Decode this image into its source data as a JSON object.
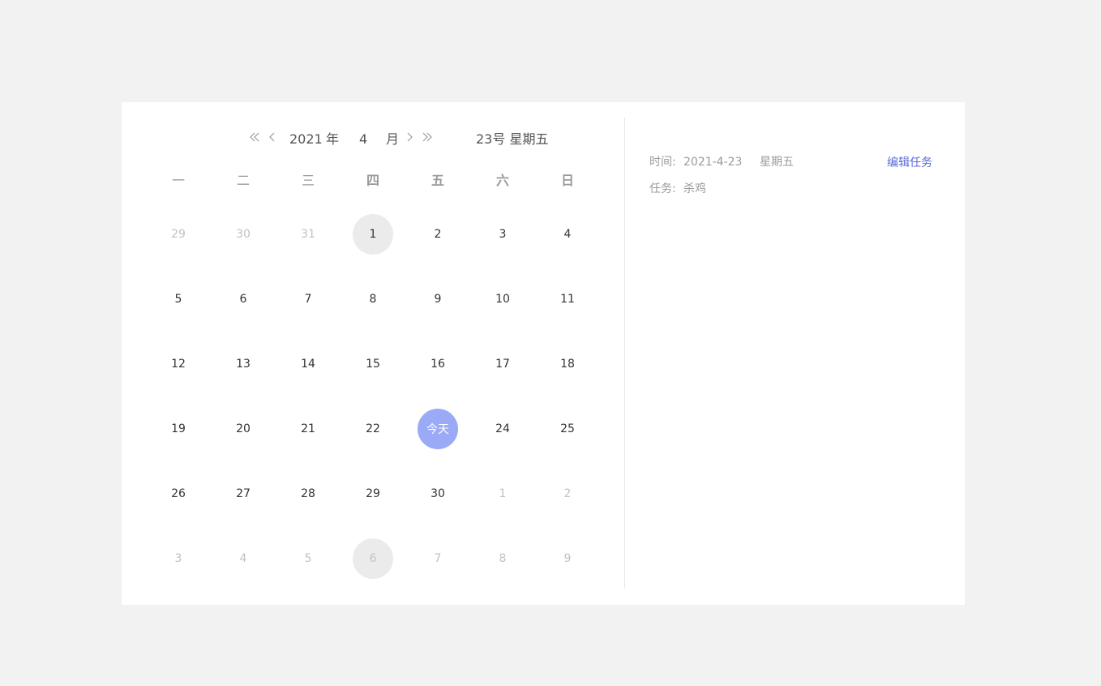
{
  "calendar": {
    "nav": {
      "prev_year_icon": "double-chevron-left-icon",
      "prev_month_icon": "chevron-left-icon",
      "next_month_icon": "chevron-right-icon",
      "next_year_icon": "double-chevron-right-icon"
    },
    "year": "2021",
    "year_suffix": "年",
    "month": "4",
    "month_suffix": "月",
    "selected_day_label": "23号 星期五",
    "weekdays": [
      "一",
      "二",
      "三",
      "四",
      "五",
      "六",
      "日"
    ],
    "weeks": [
      [
        {
          "text": "29",
          "state": "other"
        },
        {
          "text": "30",
          "state": "other"
        },
        {
          "text": "31",
          "state": "other"
        },
        {
          "text": "1",
          "state": "hl"
        },
        {
          "text": "2",
          "state": "cur"
        },
        {
          "text": "3",
          "state": "cur"
        },
        {
          "text": "4",
          "state": "cur"
        }
      ],
      [
        {
          "text": "5",
          "state": "cur"
        },
        {
          "text": "6",
          "state": "cur"
        },
        {
          "text": "7",
          "state": "cur"
        },
        {
          "text": "8",
          "state": "cur"
        },
        {
          "text": "9",
          "state": "cur"
        },
        {
          "text": "10",
          "state": "cur"
        },
        {
          "text": "11",
          "state": "cur"
        }
      ],
      [
        {
          "text": "12",
          "state": "cur"
        },
        {
          "text": "13",
          "state": "cur"
        },
        {
          "text": "14",
          "state": "cur"
        },
        {
          "text": "15",
          "state": "cur"
        },
        {
          "text": "16",
          "state": "cur"
        },
        {
          "text": "17",
          "state": "cur"
        },
        {
          "text": "18",
          "state": "cur"
        }
      ],
      [
        {
          "text": "19",
          "state": "cur"
        },
        {
          "text": "20",
          "state": "cur"
        },
        {
          "text": "21",
          "state": "cur"
        },
        {
          "text": "22",
          "state": "cur"
        },
        {
          "text": "今天",
          "state": "today"
        },
        {
          "text": "24",
          "state": "cur"
        },
        {
          "text": "25",
          "state": "cur"
        }
      ],
      [
        {
          "text": "26",
          "state": "cur"
        },
        {
          "text": "27",
          "state": "cur"
        },
        {
          "text": "28",
          "state": "cur"
        },
        {
          "text": "29",
          "state": "cur"
        },
        {
          "text": "30",
          "state": "cur"
        },
        {
          "text": "1",
          "state": "other"
        },
        {
          "text": "2",
          "state": "other"
        }
      ],
      [
        {
          "text": "3",
          "state": "other"
        },
        {
          "text": "4",
          "state": "other"
        },
        {
          "text": "5",
          "state": "other"
        },
        {
          "text": "6",
          "state": "other-hl"
        },
        {
          "text": "7",
          "state": "other"
        },
        {
          "text": "8",
          "state": "other"
        },
        {
          "text": "9",
          "state": "other"
        }
      ]
    ]
  },
  "panel": {
    "time_label": "时间:",
    "time_value": "2021-4-23",
    "weekday_value": "星期五",
    "edit_label": "编辑任务",
    "task_label": "任务:",
    "task_value": "杀鸡"
  },
  "colors": {
    "accent": "#9aaaf7",
    "link": "#5a6bd6",
    "background": "#f2f2f2"
  }
}
